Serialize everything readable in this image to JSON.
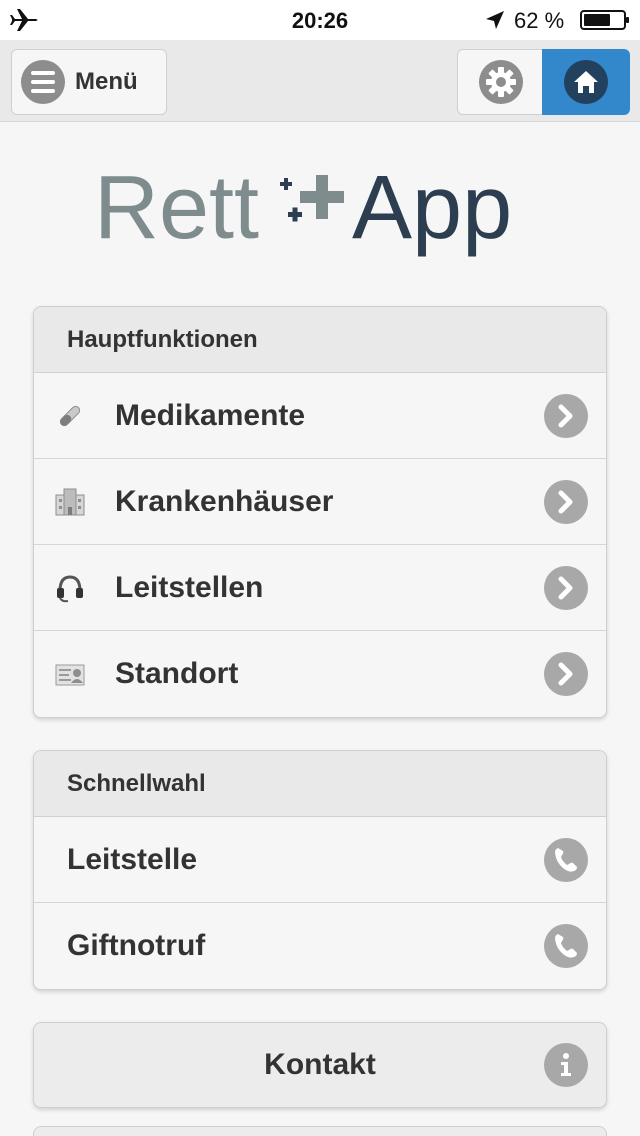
{
  "status_bar": {
    "time": "20:26",
    "battery_text": "62 %",
    "icons": [
      "airplane-icon",
      "location-arrow-icon",
      "battery-icon"
    ]
  },
  "toolbar": {
    "menu_label": "Menü",
    "menu_icon": "hamburger-icon",
    "settings_icon": "gear-icon",
    "home_icon": "home-icon",
    "accent_color": "#3388cc"
  },
  "logo": {
    "part1": "Rett",
    "part2": "App",
    "color_part1": "#7f8c8d",
    "color_part2": "#2c3e50"
  },
  "hauptfunktionen": {
    "header": "Hauptfunktionen",
    "items": [
      {
        "label": "Medikamente",
        "icon": "pill-icon"
      },
      {
        "label": "Krankenhäuser",
        "icon": "hospital-icon"
      },
      {
        "label": "Leitstellen",
        "icon": "headset-icon"
      },
      {
        "label": "Standort",
        "icon": "location-card-icon"
      }
    ]
  },
  "schnellwahl": {
    "header": "Schnellwahl",
    "items": [
      {
        "label": "Leitstelle",
        "icon": "phone-icon"
      },
      {
        "label": "Giftnotruf",
        "icon": "phone-icon"
      }
    ]
  },
  "kontakt": {
    "label": "Kontakt",
    "icon": "info-icon"
  }
}
